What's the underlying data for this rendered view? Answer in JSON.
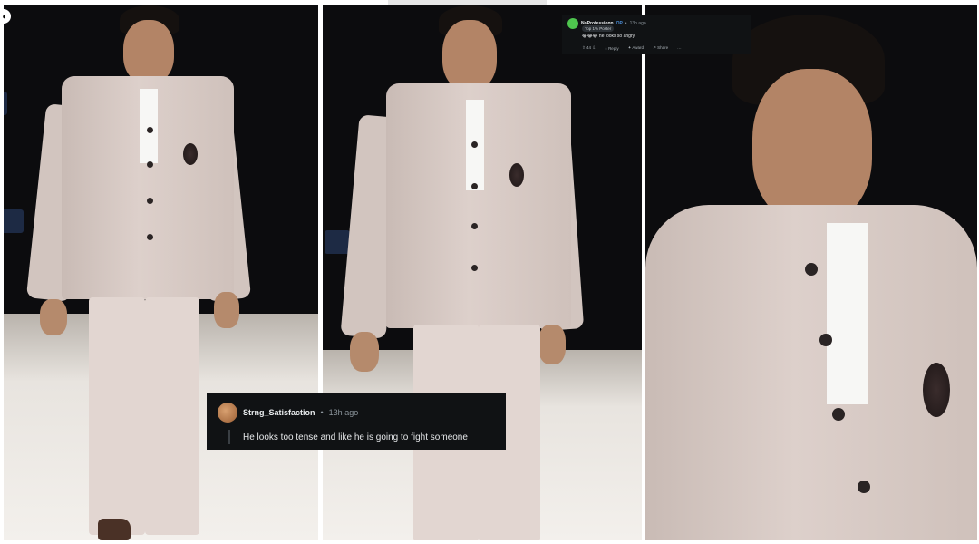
{
  "images": [
    {
      "label": "runway-full-length-photo"
    },
    {
      "label": "runway-walk-photo"
    },
    {
      "label": "closeup-portrait-photo"
    }
  ],
  "main_comment": {
    "username": "Strng_Satisfaction",
    "separator": "•",
    "timestamp": "13h ago",
    "text": "He looks too tense and like he is going to fight someone"
  },
  "top_comment": {
    "username": "NoProfessionn",
    "op_badge": "OP",
    "separator": "•",
    "timestamp": "13h ago",
    "flair": "Top 1% Poster",
    "emojis": "😂😂😂",
    "text": "he looks so angry",
    "vote_count": "44",
    "reply_label": "Reply",
    "award_label": "Award",
    "share_label": "Share",
    "more_label": "···"
  },
  "colors": {
    "comment_bg": "#101214",
    "op_blue": "#4a8cd6",
    "avatar_green": "#4ec54e",
    "suit": "#d6c9c3"
  }
}
